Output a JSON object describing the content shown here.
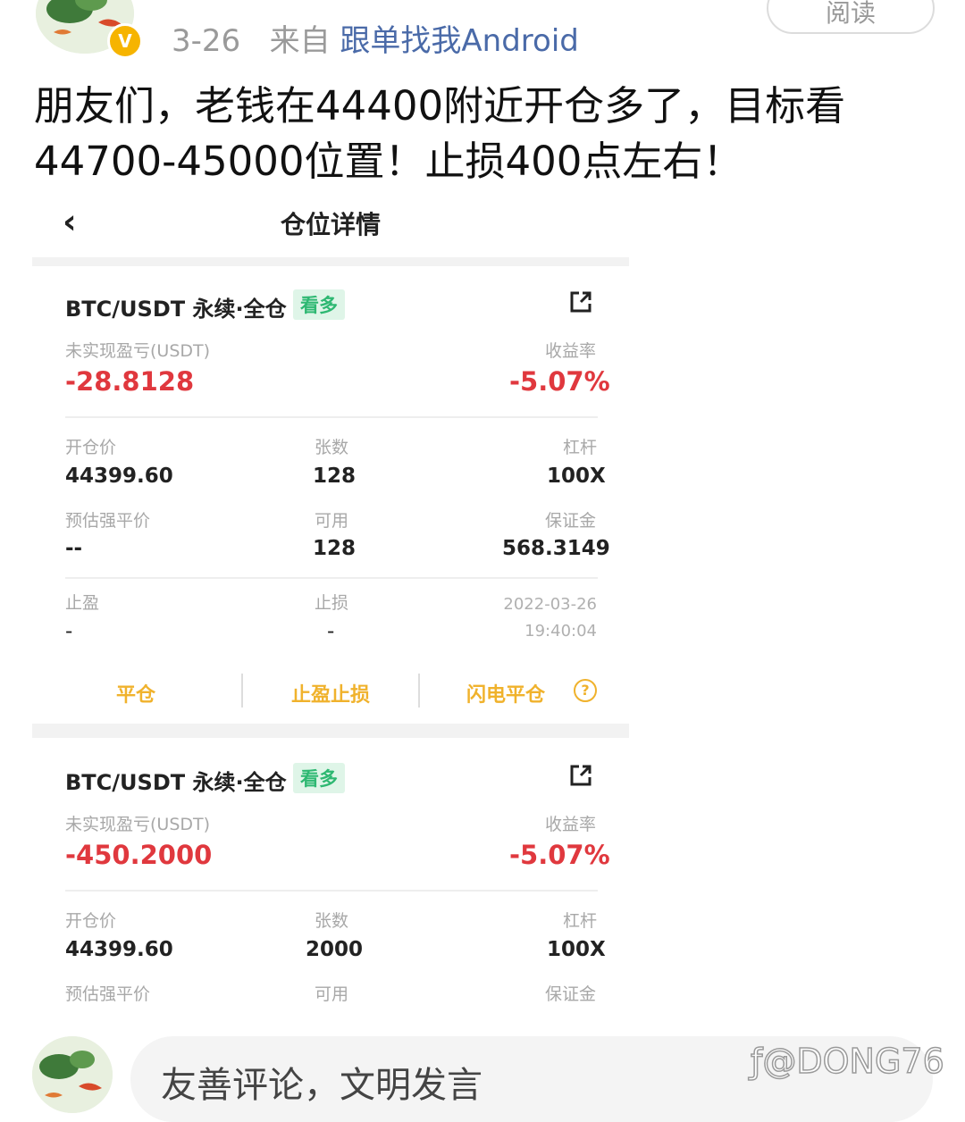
{
  "header": {
    "date": "3-26",
    "from_prefix": "来自",
    "source": "跟单找我Android",
    "read_button": "阅读",
    "verified_badge": "V"
  },
  "post": {
    "line1": "朋友们，老钱在44400附近开仓多了，目标看",
    "line2": "44700-45000位置！止损400点左右！"
  },
  "screenshot": {
    "title": "仓位详情",
    "back_icon": "chevron-left-icon",
    "positions": [
      {
        "pair": "BTC/USDT 永续·全仓",
        "tag": "看多",
        "pnl_label": "未实现盈亏(USDT)",
        "pnl": "-28.8128",
        "roe_label": "收益率",
        "roe": "-5.07%",
        "entry_label": "开仓价",
        "entry": "44399.60",
        "qty_label": "张数",
        "qty": "128",
        "lev_label": "杠杆",
        "lev": "100X",
        "liq_label": "预估强平价",
        "liq": "--",
        "avail_label": "可用",
        "avail": "128",
        "margin_label": "保证金",
        "margin": "568.3149",
        "tp_label": "止盈",
        "tp": "-",
        "sl_label": "止损",
        "sl": "-",
        "date": "2022-03-26",
        "time": "19:40:04",
        "actions": [
          "平仓",
          "止盈止损",
          "闪电平仓"
        ]
      },
      {
        "pair": "BTC/USDT 永续·全仓",
        "tag": "看多",
        "pnl_label": "未实现盈亏(USDT)",
        "pnl": "-450.2000",
        "roe_label": "收益率",
        "roe": "-5.07%",
        "entry_label": "开仓价",
        "entry": "44399.60",
        "qty_label": "张数",
        "qty": "2000",
        "lev_label": "杠杆",
        "lev": "100X",
        "liq_label": "预估强平价",
        "avail_label": "可用",
        "margin_label": "保证金"
      }
    ]
  },
  "comment": {
    "placeholder": "友善评论，文明发言"
  },
  "watermark": "@DONG76",
  "colors": {
    "loss_red": "#e0383e",
    "long_green": "#2eb872",
    "action_yellow": "#f0b22c",
    "link_blue": "#4a6aa8"
  }
}
